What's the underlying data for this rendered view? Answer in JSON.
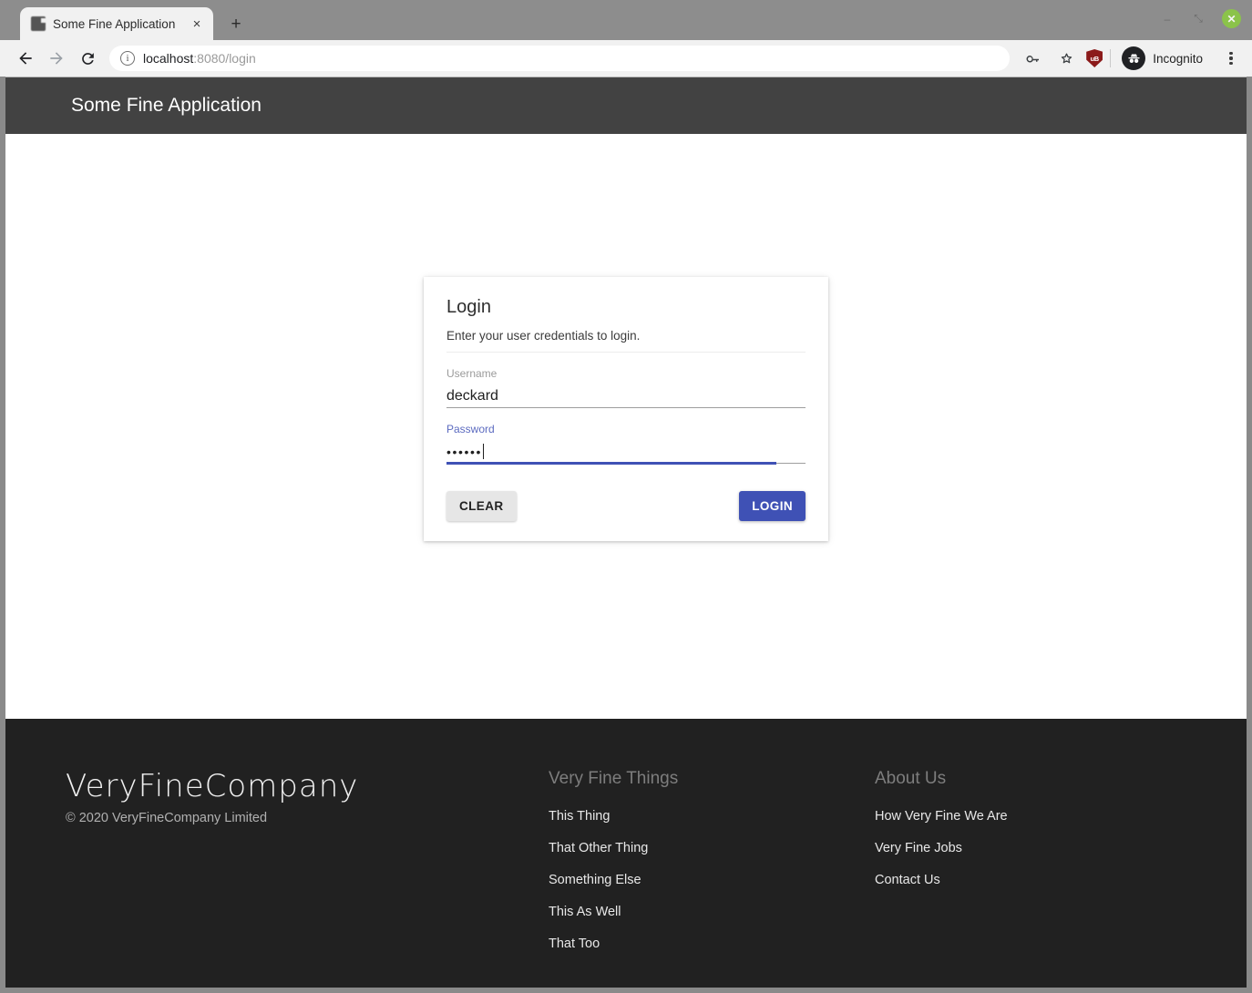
{
  "browser": {
    "tab": {
      "title": "Some Fine Application",
      "favicon_icon": "page-icon",
      "close_icon": "×"
    },
    "new_tab_icon": "+",
    "window_controls": {
      "minimize_icon": "–",
      "maximize_icon": "⤡",
      "close_icon": "✕"
    },
    "toolbar": {
      "back_icon": "arrow-left-icon",
      "forward_icon": "arrow-right-icon",
      "reload_icon": "reload-icon",
      "site_info_icon": "ⓘ",
      "url_host": "localhost",
      "url_path": ":8080/login",
      "url_full": "localhost:8080/login",
      "key_icon": "key-icon",
      "bookmark_icon": "star-icon",
      "ublock_label": "uB",
      "profile_label": "Incognito",
      "menu_icon": "kebab-menu-icon"
    }
  },
  "appbar": {
    "title": "Some Fine Application"
  },
  "login_card": {
    "title": "Login",
    "subtitle": "Enter your user credentials to login.",
    "username": {
      "label": "Username",
      "value": "deckard",
      "focused": false
    },
    "password": {
      "label": "Password",
      "value": "••••••",
      "focused": true
    },
    "clear_label": "CLEAR",
    "login_label": "LOGIN"
  },
  "footer": {
    "brand": "VeryFineCompany",
    "copyright": "© 2020 VeryFineCompany Limited",
    "columns": [
      {
        "heading": "Very Fine Things",
        "links": [
          "This Thing",
          "That Other Thing",
          "Something Else",
          "This As Well",
          "That Too"
        ]
      },
      {
        "heading": "About Us",
        "links": [
          "How Very Fine We Are",
          "Very Fine Jobs",
          "Contact Us"
        ]
      }
    ]
  },
  "colors": {
    "appbar_bg": "#424242",
    "footer_bg": "#212121",
    "accent": "#3f51b5",
    "chrome_bg": "#8d8d8d"
  }
}
